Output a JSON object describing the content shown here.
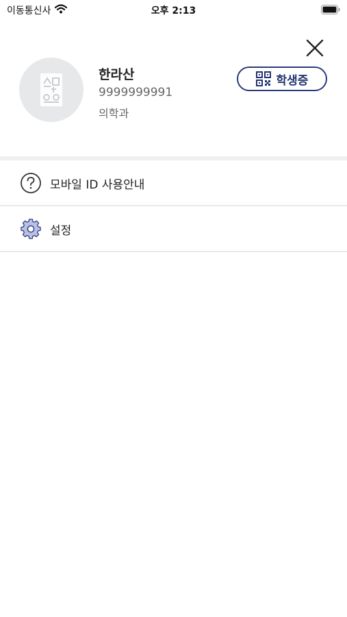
{
  "status_bar": {
    "carrier": "이동통신사",
    "time": "오후 2:13"
  },
  "profile": {
    "name": "한라산",
    "student_id": "9999999991",
    "department": "의학과"
  },
  "id_card_button": {
    "label": "학생증"
  },
  "menu": {
    "items": [
      {
        "label": "모바일 ID 사용안내",
        "icon": "help-circle-icon"
      },
      {
        "label": "설정",
        "icon": "gear-icon"
      }
    ]
  },
  "colors": {
    "accent": "#23336e",
    "avatar_bg": "#e6e8ea",
    "divider": "#eeeff1"
  }
}
